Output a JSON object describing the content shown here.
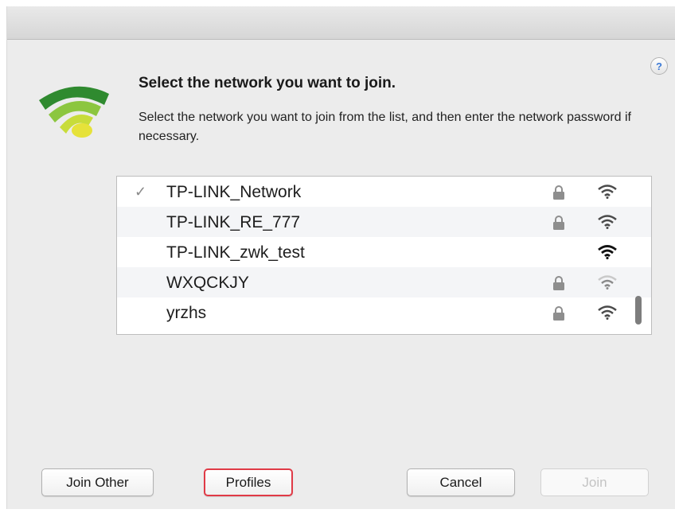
{
  "dialog": {
    "heading": "Select the network you want to join.",
    "description": "Select the network you want to join from the list, and then enter the network password if necessary.",
    "help_label": "?"
  },
  "networks": [
    {
      "name": "TP-LINK_Network",
      "selected": true,
      "check": "✓",
      "secured": true,
      "signal": 3
    },
    {
      "name": "TP-LINK_RE_777",
      "selected": false,
      "secured": true,
      "signal": 3
    },
    {
      "name": "TP-LINK_zwk_test",
      "selected": false,
      "secured": false,
      "signal": 4
    },
    {
      "name": "WXQCKJY",
      "selected": false,
      "secured": true,
      "signal": 2
    },
    {
      "name": "yrzhs",
      "selected": false,
      "secured": true,
      "signal": 3
    }
  ],
  "buttons": {
    "join_other": "Join Other",
    "profiles": "Profiles",
    "cancel": "Cancel",
    "join": "Join"
  },
  "colors": {
    "highlight": "#e03a46",
    "wifi_dark_green": "#2f8a2f",
    "wifi_light_green": "#8cc63f",
    "wifi_yellow": "#e6e23a"
  }
}
